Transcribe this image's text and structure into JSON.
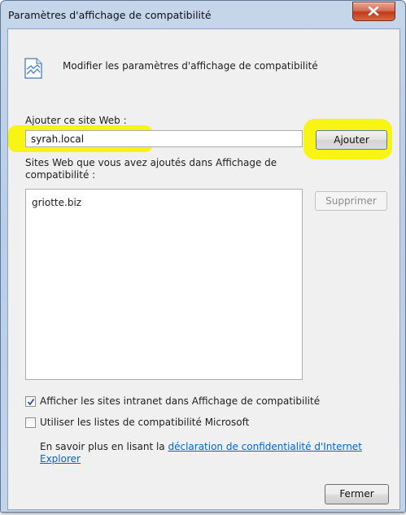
{
  "window": {
    "title": "Paramètres d'affichage de compatibilité"
  },
  "header": {
    "text": "Modifier les paramètres d'affichage de compatibilité"
  },
  "add_site": {
    "label": "Ajouter ce site Web :",
    "input_value": "syrah.local",
    "button_label": "Ajouter"
  },
  "sites": {
    "label": "Sites Web que vous avez ajoutés dans Affichage de compatibilité :",
    "items": [
      "griotte.biz"
    ],
    "remove_label": "Supprimer"
  },
  "options": {
    "intranet": {
      "label": "Afficher les sites intranet dans Affichage de compatibilité",
      "checked": true
    },
    "microsoft_lists": {
      "label": "Utiliser les listes de compatibilité Microsoft",
      "checked": false
    }
  },
  "info": {
    "prefix": "En savoir plus en lisant la ",
    "link_text": "déclaration de confidentialité d'Internet Explorer"
  },
  "footer": {
    "close_label": "Fermer"
  },
  "colors": {
    "highlight": "#f8f400",
    "link": "#0066cc",
    "window_frame": "#b9cde6"
  }
}
